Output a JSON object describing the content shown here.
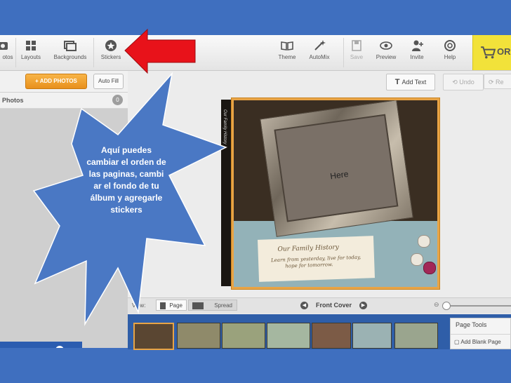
{
  "toolbar": {
    "photos_label": "otos",
    "layouts_label": "Layouts",
    "backgrounds_label": "Backgrounds",
    "stickers_label": "Stickers",
    "theme_label": "Theme",
    "automix_label": "AutoMix",
    "save_label": "Save",
    "preview_label": "Preview",
    "invite_label": "Invite",
    "help_label": "Help",
    "order_label": "ORD"
  },
  "left_panel": {
    "add_photos": "+ ADD PHOTOS",
    "auto_fill": "Auto Fill",
    "photos_header": "Photos",
    "photos_count": "0"
  },
  "canvas": {
    "add_text": "Add Text",
    "undo": "Undo",
    "redo": "Re",
    "frame_placeholder": "Here",
    "journal_title": "Our Family History",
    "journal_quote_1": "Learn from yesterday, live for today,",
    "journal_quote_2": "hope for tomorrow."
  },
  "bottom_bar": {
    "view_label": "View:",
    "page_button": "Page",
    "spread_button": "Spread",
    "current_page": "Front Cover"
  },
  "page_tools": {
    "title": "Page Tools",
    "add_blank_page": "Add Blank Page"
  },
  "annotation": {
    "callout_text": "Aquí puedes cambiar el orden de las paginas, cambi ar el fondo de tu álbum y agregarle stickers",
    "callout_color": "#4a78c4",
    "arrow_color": "#e8121a"
  },
  "colors": {
    "slide_background": "#3f6fbf",
    "order_button": "#f2e23a",
    "add_photos_button": "#f0a030",
    "page_border": "#e8a446"
  }
}
